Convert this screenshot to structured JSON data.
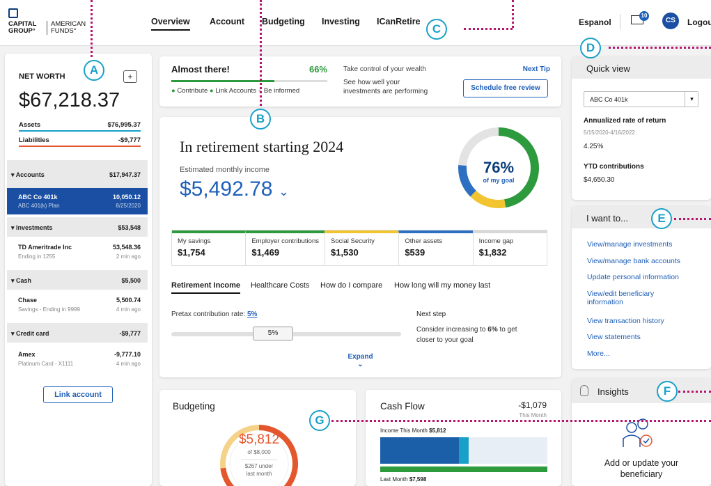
{
  "brand": {
    "line1": "CAPITAL",
    "line2": "GROUP°",
    "line3": "AMERICAN",
    "line4": "FUNDS°"
  },
  "nav": {
    "items": [
      "Overview",
      "Account",
      "Budgeting",
      "Investing",
      "ICanRetire"
    ],
    "active": "Overview"
  },
  "header_right": {
    "language": "Espanol",
    "mail_count": "10",
    "avatar_initials": "CS",
    "logout": "Logout"
  },
  "markers": [
    "A",
    "B",
    "C",
    "D",
    "E",
    "F",
    "G"
  ],
  "net_worth": {
    "title": "NET WORTH",
    "add_icon": "+",
    "value": "$67,218.37",
    "assets_label": "Assets",
    "assets_value": "$76,995.37",
    "liabilities_label": "Liabilities",
    "liabilities_value": "-$9,777"
  },
  "accounts": {
    "sections": [
      {
        "label": "Accounts",
        "total": "$17,947.37"
      },
      {
        "label": "Investments",
        "total": "$53,548"
      },
      {
        "label": "Cash",
        "total": "$5,500"
      },
      {
        "label": "Credit card",
        "total": "-$9,777"
      }
    ],
    "items": [
      {
        "name": "ABC Co 401k",
        "sub": "ABC 401(k) Plan",
        "value": "10,050.12",
        "time": "8/25/2020"
      },
      {
        "name": "TD Ameritrade Inc",
        "sub": "Ending in 1255",
        "value": "53,548.36",
        "time": "2 min ago"
      },
      {
        "name": "Chase",
        "sub": "Savings - Ending in 9999",
        "value": "5,500.74",
        "time": "4 min ago"
      },
      {
        "name": "Amex",
        "sub": "Platinum Card - X1111",
        "value": "-9,777.10",
        "time": "4 min ago"
      }
    ],
    "link_button": "Link account"
  },
  "progress": {
    "title": "Almost there!",
    "percent_text": "66%",
    "percent": 0.66,
    "steps": [
      "Contribute",
      "Link Accounts",
      "Be informed"
    ],
    "tip_title": "Take control of your wealth",
    "tip_body_1": "See how well your",
    "tip_body_2": "investments are performing",
    "next_tip": "Next Tip",
    "review_button": "Schedule free review"
  },
  "retirement": {
    "title": "In retirement starting 2024",
    "subtitle": "Estimated monthly income",
    "amount": "$5,492.78",
    "goal_percent_text": "76%",
    "goal_label": "of my goal",
    "goal_fraction": 0.76,
    "breakdown": [
      {
        "label": "My savings",
        "value": "$1,754",
        "color": "#2e9a3e"
      },
      {
        "label": "Employer contributions",
        "value": "$1,469",
        "color": "#2e9a3e"
      },
      {
        "label": "Social Security",
        "value": "$1,530",
        "color": "#f2c430"
      },
      {
        "label": "Other assets",
        "value": "$539",
        "color": "#2d6fc1"
      },
      {
        "label": "Income gap",
        "value": "$1,832",
        "color": "#d8d8d8"
      }
    ],
    "tabs": [
      "Retirement Income",
      "Healthcare Costs",
      "How do I compare",
      "How long will my money last"
    ],
    "contribution_label": "Pretax contribution rate:",
    "contribution_link": "5%",
    "slider_value": "5%",
    "next_step_title": "Next step",
    "next_step_pre": "Consider increasing to",
    "next_step_rate": "6%",
    "next_step_post": "to get",
    "next_step_line2": "closer to your goal",
    "expand": "Expand"
  },
  "quick_view": {
    "title": "Quick view",
    "select_value": "ABC Co 401k",
    "rate_label": "Annualized rate of return",
    "rate_dates": "5/15/2020-4/16/2022",
    "rate_value": "4.25%",
    "ytd_label": "YTD contributions",
    "ytd_value": "$4,650.30"
  },
  "i_want_to": {
    "title": "I want to...",
    "links": [
      "View/manage investments",
      "View/manage bank accounts",
      "Update personal information",
      "View/edit beneficiary information",
      "View transaction history",
      "View statements",
      "More..."
    ]
  },
  "insights": {
    "title": "Insights",
    "message_line1": "Add or update your",
    "message_line2": "beneficiary"
  },
  "budgeting": {
    "title": "Budgeting",
    "amount": "$5,812",
    "of_label": "of $8,000",
    "under_1": "$267 under",
    "under_2": "last month",
    "fraction": 0.73
  },
  "cash_flow": {
    "title": "Cash Flow",
    "net": "-$1,079",
    "period": "This Month",
    "income_label": "Income This Month",
    "income_value": "$5,812",
    "last_label": "Last Month",
    "last_value": "$7,598",
    "income_fraction": 0.47,
    "highlight_fraction": 0.06,
    "last_fraction": 1.0
  },
  "colors": {
    "accent": "#1e5fb8",
    "navy": "#1a4fa3",
    "green": "#2e9a3e",
    "yellow": "#f2c430",
    "orange": "#e4572e",
    "marker": "#19a0c8",
    "connector": "#b5156e"
  }
}
